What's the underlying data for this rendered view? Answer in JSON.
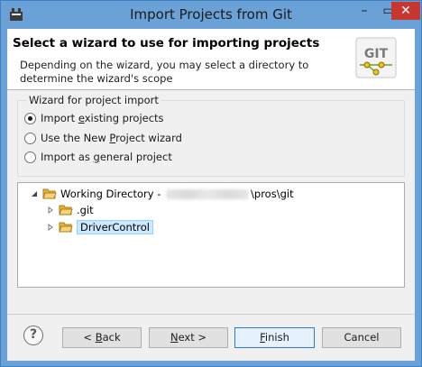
{
  "window": {
    "title": "Import Projects from Git",
    "minimize_glyph": "–",
    "maximize_glyph": "▭",
    "close_glyph": "✕"
  },
  "header": {
    "title": "Select a wizard to use for importing projects",
    "description": "Depending on the wizard, you may select a directory to determine the wizard's scope",
    "logo_text": "GIT"
  },
  "wizard_group": {
    "title": "Wizard for project import",
    "options": [
      {
        "pre": "Import ",
        "mnemonic": "e",
        "post": "xisting projects",
        "checked": true
      },
      {
        "pre": "Use the New ",
        "mnemonic": "P",
        "post": "roject wizard",
        "checked": false
      },
      {
        "pre": "Import as ",
        "mnemonic": "g",
        "post": "eneral project",
        "checked": false
      }
    ]
  },
  "tree": {
    "root": {
      "prefix": "Working Directory - ",
      "suffix": "\\pros\\git",
      "expanded": true
    },
    "children": [
      {
        "label": ".git",
        "selected": false
      },
      {
        "label": "DriverControl",
        "selected": true
      }
    ]
  },
  "buttons": {
    "back": {
      "pre": "< ",
      "mnemonic": "B",
      "post": "ack"
    },
    "next": {
      "pre": "",
      "mnemonic": "N",
      "post": "ext >"
    },
    "finish": {
      "pre": "",
      "mnemonic": "F",
      "post": "inish"
    },
    "cancel": {
      "pre": "Cancel",
      "mnemonic": "",
      "post": ""
    },
    "help": "?"
  },
  "colors": {
    "title_bar": "#6aa1d6",
    "close_button": "#c7372f",
    "selection": "#cce8ff",
    "default_button_border": "#2b79d6"
  }
}
